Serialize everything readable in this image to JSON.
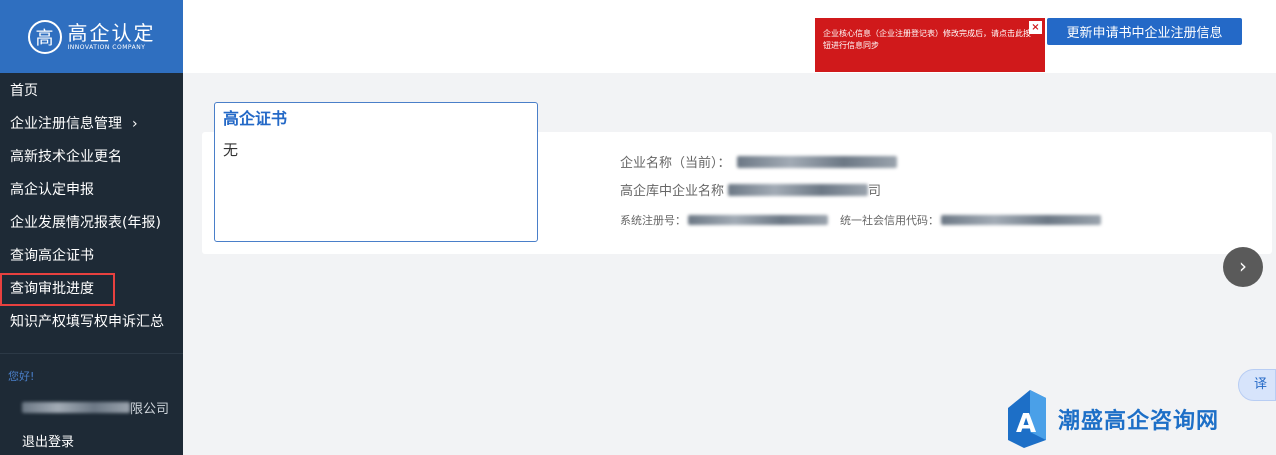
{
  "logo": {
    "title": "高企认定",
    "subtitle": "INNOVATION COMPANY",
    "mark": "高"
  },
  "nav": {
    "items": [
      {
        "label": "首页"
      },
      {
        "label": "企业注册信息管理",
        "chevron": "›"
      },
      {
        "label": "高新技术企业更名"
      },
      {
        "label": "高企认定申报"
      },
      {
        "label": "企业发展情况报表(年报)"
      },
      {
        "label": "查询高企证书"
      },
      {
        "label": "查询审批进度"
      },
      {
        "label": "知识产权填写权申诉汇总"
      }
    ]
  },
  "user": {
    "greeting": "您好!",
    "company_suffix": "限公司",
    "logout": "退出登录"
  },
  "alert": {
    "text": "企业核心信息（企业注册登记表）修改完成后，请点击此按钮进行信息同步",
    "close": "×"
  },
  "sync_button": "更新申请书中企业注册信息",
  "cert": {
    "title": "高企证书",
    "value": "无"
  },
  "info": {
    "current_name_label": "企业名称（当前）：",
    "library_name_label": "高企库中企业名称",
    "library_name_suffix": "司",
    "reg_no_label": "系统注册号：",
    "credit_code_label": "统一社会信用代码："
  },
  "controls": {
    "next_arrow": "›",
    "translate": "译"
  },
  "watermark": {
    "text": "潮盛高企咨询网"
  },
  "colors": {
    "sidebar": "#1e2a36",
    "brand": "#2f6fc0",
    "accent": "#2469c7",
    "alert": "#d0191b",
    "highlight": "#e8413f"
  }
}
